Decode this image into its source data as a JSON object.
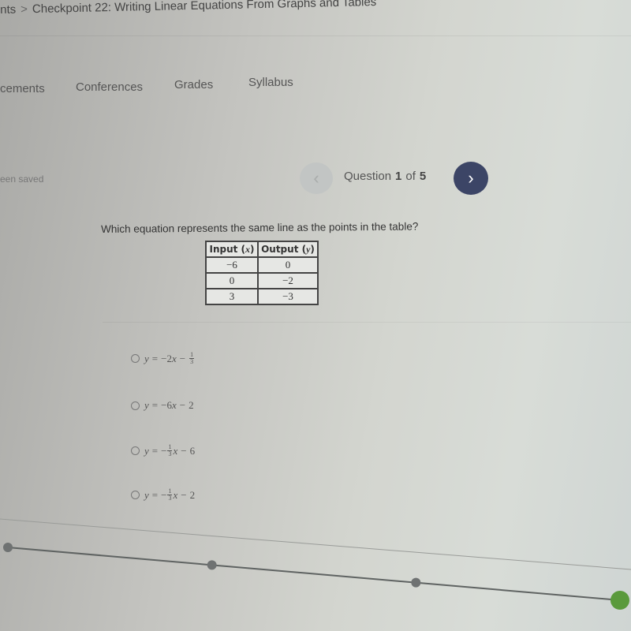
{
  "breadcrumb": {
    "parent": "nts",
    "separator": ">",
    "current": "Checkpoint 22: Writing Linear Equations From Graphs and Tables"
  },
  "nav": {
    "items": [
      {
        "label": "cements"
      },
      {
        "label": "Conferences"
      },
      {
        "label": "Grades"
      },
      {
        "label": "Syllabus"
      }
    ]
  },
  "status": {
    "saved_text": "een saved"
  },
  "question_nav": {
    "prev_icon": "chevron-left-icon",
    "next_icon": "chevron-right-icon",
    "prev_glyph": "‹",
    "next_glyph": "›",
    "label": "Question",
    "current": "1",
    "of_label": "of",
    "total": "5"
  },
  "question": {
    "prompt": "Which equation represents the same line as the points in the table?",
    "table": {
      "headers": [
        {
          "text": "Input (",
          "var": "x",
          "close": ")"
        },
        {
          "text": "Output (",
          "var": "y",
          "close": ")"
        }
      ],
      "rows": [
        [
          "−6",
          "0"
        ],
        [
          "0",
          "−2"
        ],
        [
          "3",
          "−3"
        ]
      ]
    },
    "options": [
      {
        "lhs": "y",
        "eq": "=",
        "coef_sign": "−",
        "coef": "2",
        "coef_frac": null,
        "var": "x",
        "op": "−",
        "const": null,
        "const_frac": {
          "num": "1",
          "den": "3"
        }
      },
      {
        "lhs": "y",
        "eq": "=",
        "coef_sign": "−",
        "coef": "6",
        "coef_frac": null,
        "var": "x",
        "op": "−",
        "const": "2",
        "const_frac": null
      },
      {
        "lhs": "y",
        "eq": "=",
        "coef_sign": "−",
        "coef": null,
        "coef_frac": {
          "num": "1",
          "den": "3"
        },
        "var": "x",
        "op": "−",
        "const": "6",
        "const_frac": null
      },
      {
        "lhs": "y",
        "eq": "=",
        "coef_sign": "−",
        "coef": null,
        "coef_frac": {
          "num": "1",
          "den": "3"
        },
        "var": "x",
        "op": "−",
        "const": "2",
        "const_frac": null
      }
    ]
  },
  "progress": {
    "steps": 4,
    "current_step": 4,
    "colors": {
      "done": "#6f7272",
      "active": "#5a9a3c",
      "line": "#5f6362"
    }
  }
}
